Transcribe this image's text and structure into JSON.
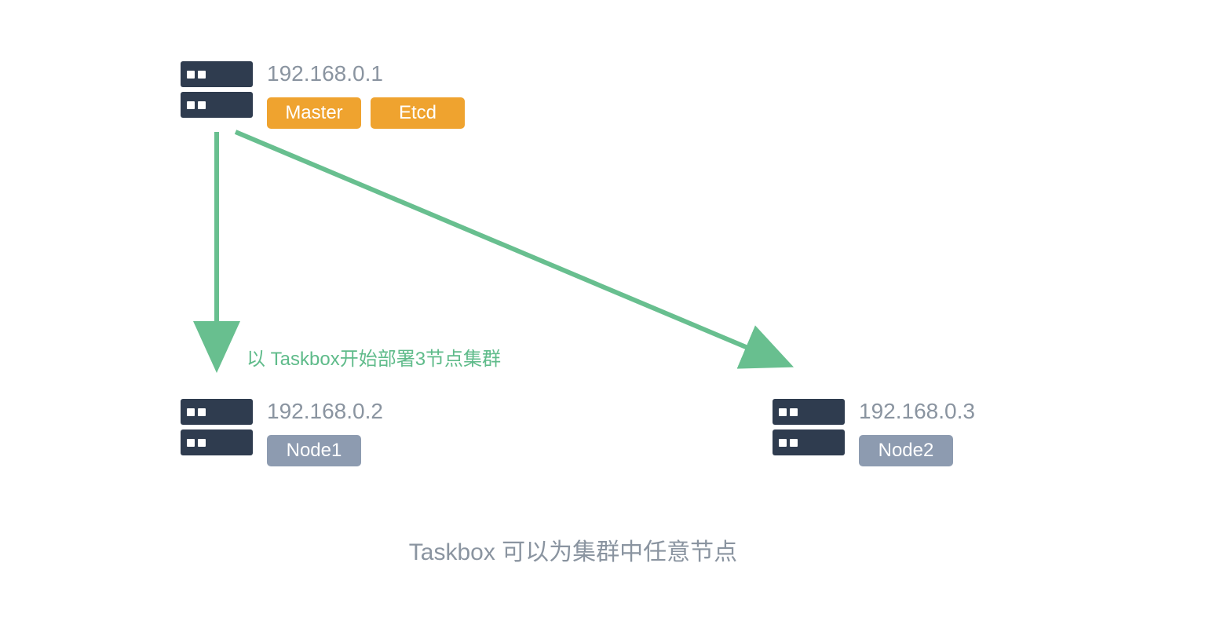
{
  "nodes": {
    "master": {
      "ip": "192.168.0.1",
      "tags": [
        "Master",
        "Etcd"
      ],
      "tag_color": "orange"
    },
    "node1": {
      "ip": "192.168.0.2",
      "tags": [
        "Node1"
      ],
      "tag_color": "gray"
    },
    "node2": {
      "ip": "192.168.0.3",
      "tags": [
        "Node2"
      ],
      "tag_color": "gray"
    }
  },
  "arrow_label": "以 Taskbox开始部署3节点集群",
  "footer_note": "Taskbox 可以为集群中任意节点",
  "colors": {
    "server_dark": "#2f3c4f",
    "tag_orange": "#efa32f",
    "tag_gray": "#8d9bb0",
    "arrow_green": "#68bf8f",
    "text_gray": "#8a94a0"
  }
}
